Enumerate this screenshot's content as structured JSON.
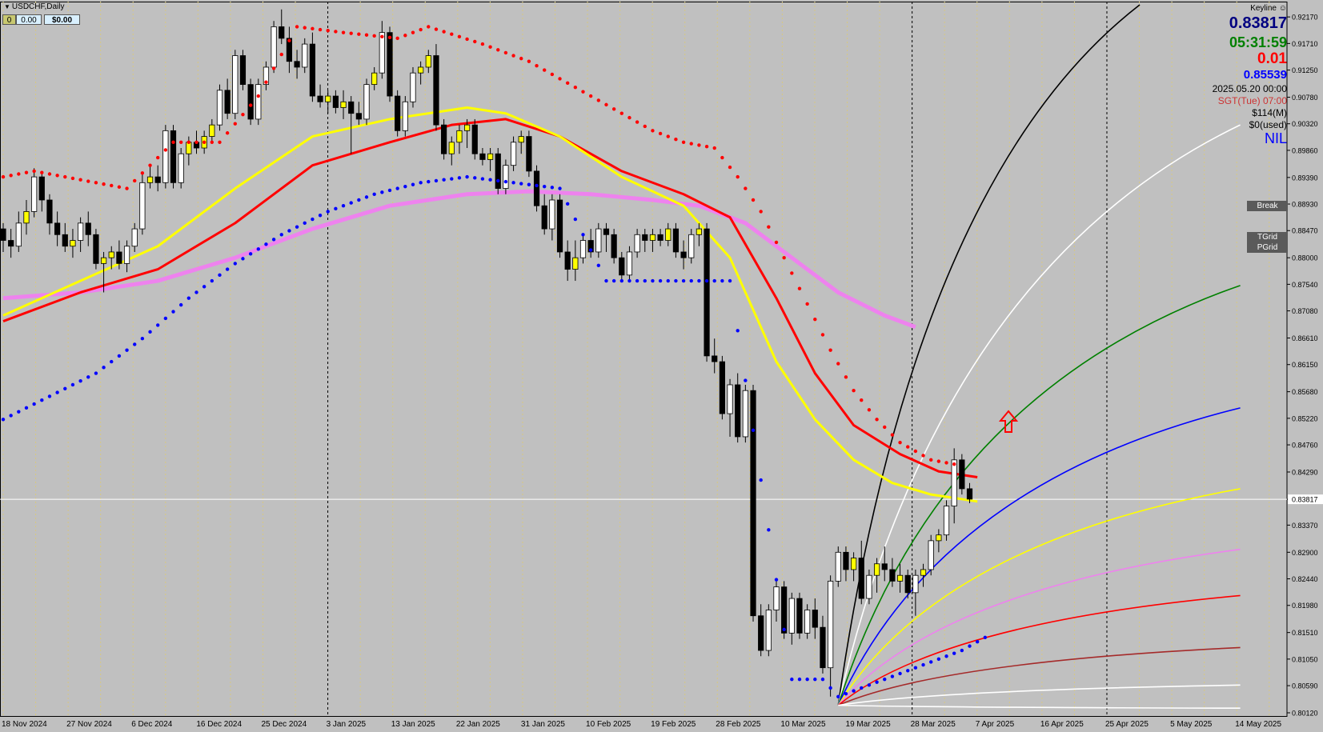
{
  "header": {
    "symbol_title": "USDCHF,Daily",
    "box0": "0",
    "box1": "0.00",
    "box2": "$0.00"
  },
  "info_panel": {
    "keyline_label": "Keyline",
    "bid_price": "0.83817",
    "countdown": "05:31:59",
    "spread": "0.01",
    "level_price": "0.85539",
    "datetime": "2025.05.20 00:00",
    "session": "SGT(Tue) 07:00",
    "margin": "$114(M)",
    "used": "$0(used)",
    "status": "NIL",
    "colors": {
      "bid": "#000080",
      "countdown": "#008000",
      "spread": "#ff0000",
      "level": "#0000ff",
      "session": "#cc3333",
      "status": "#0000ff"
    }
  },
  "tags": {
    "break": "Break",
    "tgrid": "TGrid",
    "pgrid": "PGrid"
  },
  "chart_data": {
    "type": "candlestick",
    "ylim": [
      0.8012,
      0.9238
    ],
    "y_ticks": [
      "0.92170",
      "0.91710",
      "0.91250",
      "0.90780",
      "0.90320",
      "0.89860",
      "0.89390",
      "0.88930",
      "0.88470",
      "0.88000",
      "0.87540",
      "0.87080",
      "0.86610",
      "0.86150",
      "0.85680",
      "0.85220",
      "0.84760",
      "0.84290",
      "0.83817",
      "0.83370",
      "0.82900",
      "0.82440",
      "0.81980",
      "0.81510",
      "0.81050",
      "0.80590",
      "0.80120"
    ],
    "x_labels": [
      "18 Nov 2024",
      "27 Nov 2024",
      "6 Dec 2024",
      "16 Dec 2024",
      "25 Dec 2024",
      "3 Jan 2025",
      "13 Jan 2025",
      "22 Jan 2025",
      "31 Jan 2025",
      "10 Feb 2025",
      "19 Feb 2025",
      "28 Feb 2025",
      "10 Mar 2025",
      "19 Mar 2025",
      "28 Mar 2025",
      "7 Apr 2025",
      "16 Apr 2025",
      "25 Apr 2025",
      "5 May 2025",
      "14 May 2025"
    ],
    "current_price": 0.83817,
    "ohlc": [
      [
        0.885,
        0.886,
        0.881,
        0.883
      ],
      [
        0.883,
        0.885,
        0.88,
        0.882
      ],
      [
        0.882,
        0.888,
        0.881,
        0.886
      ],
      [
        0.886,
        0.89,
        0.884,
        0.888
      ],
      [
        0.888,
        0.8955,
        0.887,
        0.894
      ],
      [
        0.894,
        0.895,
        0.888,
        0.89
      ],
      [
        0.89,
        0.891,
        0.884,
        0.886
      ],
      [
        0.886,
        0.888,
        0.882,
        0.884
      ],
      [
        0.884,
        0.886,
        0.881,
        0.882
      ],
      [
        0.882,
        0.885,
        0.88,
        0.883
      ],
      [
        0.883,
        0.887,
        0.881,
        0.886
      ],
      [
        0.886,
        0.888,
        0.882,
        0.884
      ],
      [
        0.884,
        0.885,
        0.878,
        0.879
      ],
      [
        0.879,
        0.881,
        0.874,
        0.88
      ],
      [
        0.88,
        0.882,
        0.878,
        0.881
      ],
      [
        0.881,
        0.883,
        0.878,
        0.879
      ],
      [
        0.879,
        0.883,
        0.8775,
        0.882
      ],
      [
        0.882,
        0.886,
        0.881,
        0.885
      ],
      [
        0.885,
        0.8945,
        0.884,
        0.893
      ],
      [
        0.893,
        0.896,
        0.892,
        0.894
      ],
      [
        0.894,
        0.896,
        0.8915,
        0.893
      ],
      [
        0.893,
        0.903,
        0.892,
        0.902
      ],
      [
        0.902,
        0.903,
        0.892,
        0.893
      ],
      [
        0.893,
        0.899,
        0.892,
        0.898
      ],
      [
        0.898,
        0.901,
        0.896,
        0.9
      ],
      [
        0.9,
        0.902,
        0.898,
        0.899
      ],
      [
        0.899,
        0.902,
        0.898,
        0.901
      ],
      [
        0.901,
        0.904,
        0.9,
        0.903
      ],
      [
        0.903,
        0.91,
        0.902,
        0.909
      ],
      [
        0.909,
        0.911,
        0.904,
        0.905
      ],
      [
        0.905,
        0.916,
        0.904,
        0.915
      ],
      [
        0.915,
        0.916,
        0.909,
        0.91
      ],
      [
        0.91,
        0.911,
        0.903,
        0.904
      ],
      [
        0.904,
        0.911,
        0.903,
        0.91
      ],
      [
        0.91,
        0.914,
        0.909,
        0.913
      ],
      [
        0.913,
        0.921,
        0.912,
        0.92
      ],
      [
        0.92,
        0.923,
        0.917,
        0.918
      ],
      [
        0.918,
        0.92,
        0.912,
        0.914
      ],
      [
        0.914,
        0.916,
        0.911,
        0.913
      ],
      [
        0.913,
        0.918,
        0.912,
        0.917
      ],
      [
        0.917,
        0.919,
        0.907,
        0.908
      ],
      [
        0.908,
        0.91,
        0.906,
        0.907
      ],
      [
        0.907,
        0.909,
        0.905,
        0.908
      ],
      [
        0.908,
        0.909,
        0.905,
        0.906
      ],
      [
        0.906,
        0.909,
        0.904,
        0.907
      ],
      [
        0.907,
        0.908,
        0.898,
        0.905
      ],
      [
        0.905,
        0.907,
        0.903,
        0.904
      ],
      [
        0.904,
        0.911,
        0.903,
        0.91
      ],
      [
        0.91,
        0.913,
        0.909,
        0.912
      ],
      [
        0.912,
        0.921,
        0.911,
        0.919
      ],
      [
        0.919,
        0.92,
        0.907,
        0.908
      ],
      [
        0.908,
        0.909,
        0.901,
        0.902
      ],
      [
        0.902,
        0.908,
        0.901,
        0.907
      ],
      [
        0.907,
        0.913,
        0.906,
        0.912
      ],
      [
        0.912,
        0.914,
        0.91,
        0.913
      ],
      [
        0.913,
        0.916,
        0.912,
        0.915
      ],
      [
        0.915,
        0.917,
        0.902,
        0.903
      ],
      [
        0.903,
        0.904,
        0.897,
        0.898
      ],
      [
        0.898,
        0.901,
        0.896,
        0.9
      ],
      [
        0.9,
        0.903,
        0.898,
        0.902
      ],
      [
        0.902,
        0.904,
        0.899,
        0.903
      ],
      [
        0.903,
        0.904,
        0.897,
        0.898
      ],
      [
        0.898,
        0.899,
        0.896,
        0.897
      ],
      [
        0.897,
        0.899,
        0.895,
        0.898
      ],
      [
        0.898,
        0.899,
        0.891,
        0.892
      ],
      [
        0.892,
        0.897,
        0.891,
        0.896
      ],
      [
        0.896,
        0.901,
        0.895,
        0.9
      ],
      [
        0.9,
        0.902,
        0.898,
        0.901
      ],
      [
        0.901,
        0.902,
        0.894,
        0.895
      ],
      [
        0.895,
        0.896,
        0.888,
        0.889
      ],
      [
        0.889,
        0.891,
        0.884,
        0.885
      ],
      [
        0.885,
        0.891,
        0.883,
        0.89
      ],
      [
        0.89,
        0.891,
        0.88,
        0.881
      ],
      [
        0.881,
        0.883,
        0.876,
        0.878
      ],
      [
        0.878,
        0.883,
        0.876,
        0.88
      ],
      [
        0.88,
        0.884,
        0.879,
        0.883
      ],
      [
        0.883,
        0.885,
        0.88,
        0.881
      ],
      [
        0.881,
        0.886,
        0.88,
        0.885
      ],
      [
        0.885,
        0.886,
        0.881,
        0.884
      ],
      [
        0.884,
        0.885,
        0.879,
        0.88
      ],
      [
        0.88,
        0.881,
        0.876,
        0.877
      ],
      [
        0.877,
        0.882,
        0.876,
        0.881
      ],
      [
        0.881,
        0.885,
        0.88,
        0.884
      ],
      [
        0.884,
        0.885,
        0.881,
        0.883
      ],
      [
        0.883,
        0.885,
        0.881,
        0.884
      ],
      [
        0.884,
        0.885,
        0.882,
        0.883
      ],
      [
        0.883,
        0.886,
        0.882,
        0.885
      ],
      [
        0.885,
        0.886,
        0.88,
        0.881
      ],
      [
        0.881,
        0.883,
        0.878,
        0.88
      ],
      [
        0.88,
        0.885,
        0.879,
        0.884
      ],
      [
        0.884,
        0.886,
        0.882,
        0.885
      ],
      [
        0.885,
        0.886,
        0.862,
        0.863
      ],
      [
        0.863,
        0.866,
        0.86,
        0.862
      ],
      [
        0.862,
        0.863,
        0.852,
        0.853
      ],
      [
        0.853,
        0.859,
        0.849,
        0.858
      ],
      [
        0.858,
        0.86,
        0.848,
        0.849
      ],
      [
        0.849,
        0.858,
        0.848,
        0.857
      ],
      [
        0.857,
        0.858,
        0.817,
        0.818
      ],
      [
        0.818,
        0.82,
        0.811,
        0.812
      ],
      [
        0.812,
        0.82,
        0.811,
        0.819
      ],
      [
        0.819,
        0.824,
        0.817,
        0.823
      ],
      [
        0.823,
        0.824,
        0.814,
        0.815
      ],
      [
        0.815,
        0.822,
        0.813,
        0.821
      ],
      [
        0.821,
        0.822,
        0.814,
        0.815
      ],
      [
        0.815,
        0.82,
        0.814,
        0.819
      ],
      [
        0.819,
        0.821,
        0.814,
        0.816
      ],
      [
        0.816,
        0.818,
        0.808,
        0.809
      ],
      [
        0.809,
        0.825,
        0.804,
        0.824
      ],
      [
        0.824,
        0.83,
        0.823,
        0.829
      ],
      [
        0.829,
        0.83,
        0.824,
        0.826
      ],
      [
        0.826,
        0.829,
        0.824,
        0.828
      ],
      [
        0.828,
        0.831,
        0.82,
        0.821
      ],
      [
        0.821,
        0.826,
        0.82,
        0.825
      ],
      [
        0.825,
        0.828,
        0.822,
        0.827
      ],
      [
        0.827,
        0.83,
        0.824,
        0.826
      ],
      [
        0.826,
        0.828,
        0.823,
        0.824
      ],
      [
        0.824,
        0.827,
        0.822,
        0.825
      ],
      [
        0.825,
        0.826,
        0.821,
        0.822
      ],
      [
        0.822,
        0.826,
        0.818,
        0.825
      ],
      [
        0.825,
        0.827,
        0.823,
        0.826
      ],
      [
        0.826,
        0.832,
        0.825,
        0.831
      ],
      [
        0.831,
        0.833,
        0.829,
        0.832
      ],
      [
        0.832,
        0.838,
        0.831,
        0.837
      ],
      [
        0.837,
        0.847,
        0.834,
        0.845
      ],
      [
        0.845,
        0.846,
        0.839,
        0.84
      ],
      [
        0.84,
        0.841,
        0.8375,
        0.8382
      ]
    ],
    "overlays": {
      "ma_fast": {
        "color": "#ffff00",
        "points": [
          [
            0,
            0.87
          ],
          [
            10,
            0.876
          ],
          [
            20,
            0.882
          ],
          [
            30,
            0.892
          ],
          [
            40,
            0.901
          ],
          [
            50,
            0.904
          ],
          [
            60,
            0.906
          ],
          [
            65,
            0.905
          ],
          [
            72,
            0.901
          ],
          [
            80,
            0.894
          ],
          [
            88,
            0.889
          ],
          [
            94,
            0.88
          ],
          [
            100,
            0.862
          ],
          [
            105,
            0.852
          ],
          [
            110,
            0.845
          ],
          [
            115,
            0.841
          ],
          [
            120,
            0.839
          ],
          [
            126,
            0.8378
          ]
        ]
      },
      "ma_mid": {
        "color": "#ff0000",
        "points": [
          [
            0,
            0.869
          ],
          [
            10,
            0.874
          ],
          [
            20,
            0.878
          ],
          [
            30,
            0.886
          ],
          [
            40,
            0.896
          ],
          [
            50,
            0.9
          ],
          [
            58,
            0.903
          ],
          [
            65,
            0.904
          ],
          [
            72,
            0.901
          ],
          [
            80,
            0.895
          ],
          [
            88,
            0.891
          ],
          [
            94,
            0.887
          ],
          [
            100,
            0.873
          ],
          [
            105,
            0.86
          ],
          [
            110,
            0.851
          ],
          [
            116,
            0.846
          ],
          [
            121,
            0.843
          ],
          [
            126,
            0.842
          ]
        ]
      },
      "ma_slow": {
        "color": "#ee82ee",
        "points": [
          [
            0,
            0.873
          ],
          [
            10,
            0.874
          ],
          [
            20,
            0.876
          ],
          [
            30,
            0.88
          ],
          [
            40,
            0.885
          ],
          [
            50,
            0.889
          ],
          [
            60,
            0.891
          ],
          [
            68,
            0.8915
          ],
          [
            76,
            0.891
          ],
          [
            84,
            0.89
          ],
          [
            90,
            0.889
          ],
          [
            96,
            0.886
          ],
          [
            102,
            0.88
          ],
          [
            108,
            0.874
          ],
          [
            114,
            0.87
          ],
          [
            118,
            0.868
          ]
        ]
      },
      "sar_top": {
        "color": "#ff0000",
        "points": [
          [
            0,
            0.894
          ],
          [
            4,
            0.895
          ],
          [
            8,
            0.894
          ],
          [
            12,
            0.893
          ],
          [
            16,
            0.892
          ],
          [
            22,
            0.9
          ],
          [
            28,
            0.9
          ],
          [
            33,
            0.908
          ],
          [
            38,
            0.92
          ],
          [
            44,
            0.919
          ],
          [
            51,
            0.918
          ],
          [
            55,
            0.92
          ],
          [
            62,
            0.917
          ],
          [
            68,
            0.914
          ],
          [
            72,
            0.911
          ],
          [
            76,
            0.908
          ],
          [
            80,
            0.905
          ],
          [
            84,
            0.902
          ],
          [
            88,
            0.9
          ],
          [
            92,
            0.899
          ],
          [
            95,
            0.894
          ],
          [
            98,
            0.888
          ],
          [
            101,
            0.88
          ],
          [
            104,
            0.872
          ],
          [
            107,
            0.864
          ],
          [
            110,
            0.857
          ],
          [
            113,
            0.852
          ],
          [
            116,
            0.848
          ],
          [
            120,
            0.845
          ],
          [
            124,
            0.844
          ]
        ]
      },
      "sar_bottom": {
        "color": "#0000ff",
        "points": [
          [
            0,
            0.852
          ],
          [
            6,
            0.856
          ],
          [
            12,
            0.86
          ],
          [
            18,
            0.866
          ],
          [
            24,
            0.873
          ],
          [
            30,
            0.879
          ],
          [
            36,
            0.884
          ],
          [
            42,
            0.888
          ],
          [
            48,
            0.891
          ],
          [
            54,
            0.893
          ],
          [
            60,
            0.894
          ],
          [
            66,
            0.893
          ],
          [
            72,
            0.892
          ],
          [
            78,
            0.876
          ],
          [
            84,
            0.876
          ],
          [
            90,
            0.876
          ],
          [
            94,
            0.876
          ],
          [
            102,
            0.807
          ],
          [
            106,
            0.807
          ],
          [
            108,
            0.804
          ],
          [
            112,
            0.806
          ],
          [
            116,
            0.808
          ],
          [
            120,
            0.81
          ],
          [
            124,
            0.812
          ],
          [
            128,
            0.815
          ]
        ]
      },
      "fan_origin": [
        108,
        0.8025
      ],
      "fan_lines": [
        {
          "color": "#000000",
          "end": [
            147,
            0.9238
          ]
        },
        {
          "color": "#ffffff",
          "end": [
            160,
            0.903
          ]
        },
        {
          "color": "#008000",
          "end": [
            160,
            0.8752
          ]
        },
        {
          "color": "#0000ff",
          "end": [
            160,
            0.854
          ]
        },
        {
          "color": "#ffff00",
          "end": [
            160,
            0.84
          ]
        },
        {
          "color": "#ee82ee",
          "end": [
            160,
            0.8295
          ]
        },
        {
          "color": "#ff0000",
          "end": [
            160,
            0.8215
          ]
        },
        {
          "color": "#a52a2a",
          "end": [
            160,
            0.8125
          ]
        },
        {
          "color": "#ffffff",
          "end": [
            160,
            0.806
          ]
        },
        {
          "color": "#ffffff",
          "end": [
            160,
            0.802
          ]
        }
      ]
    }
  }
}
